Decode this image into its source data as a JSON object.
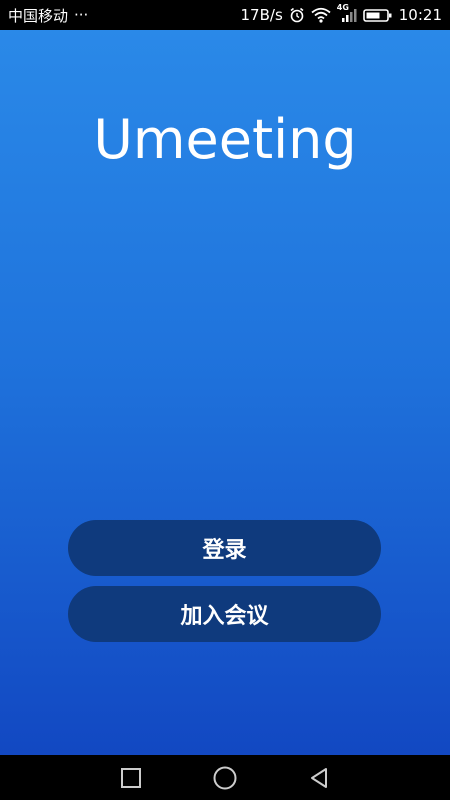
{
  "status_bar": {
    "carrier": "中国移动",
    "more": "···",
    "speed": "17B/s",
    "network": "4G",
    "time": "10:21"
  },
  "app": {
    "title": "Umeeting",
    "login_label": "登录",
    "join_label": "加入会议"
  },
  "colors": {
    "bg_top": "#2a89e8",
    "bg_bottom": "#1248c2",
    "button": "#0f3a7d"
  },
  "icons": [
    "alarm-icon",
    "wifi-icon",
    "signal-icon",
    "battery-icon",
    "nav-recents-icon",
    "nav-home-icon",
    "nav-back-icon"
  ]
}
